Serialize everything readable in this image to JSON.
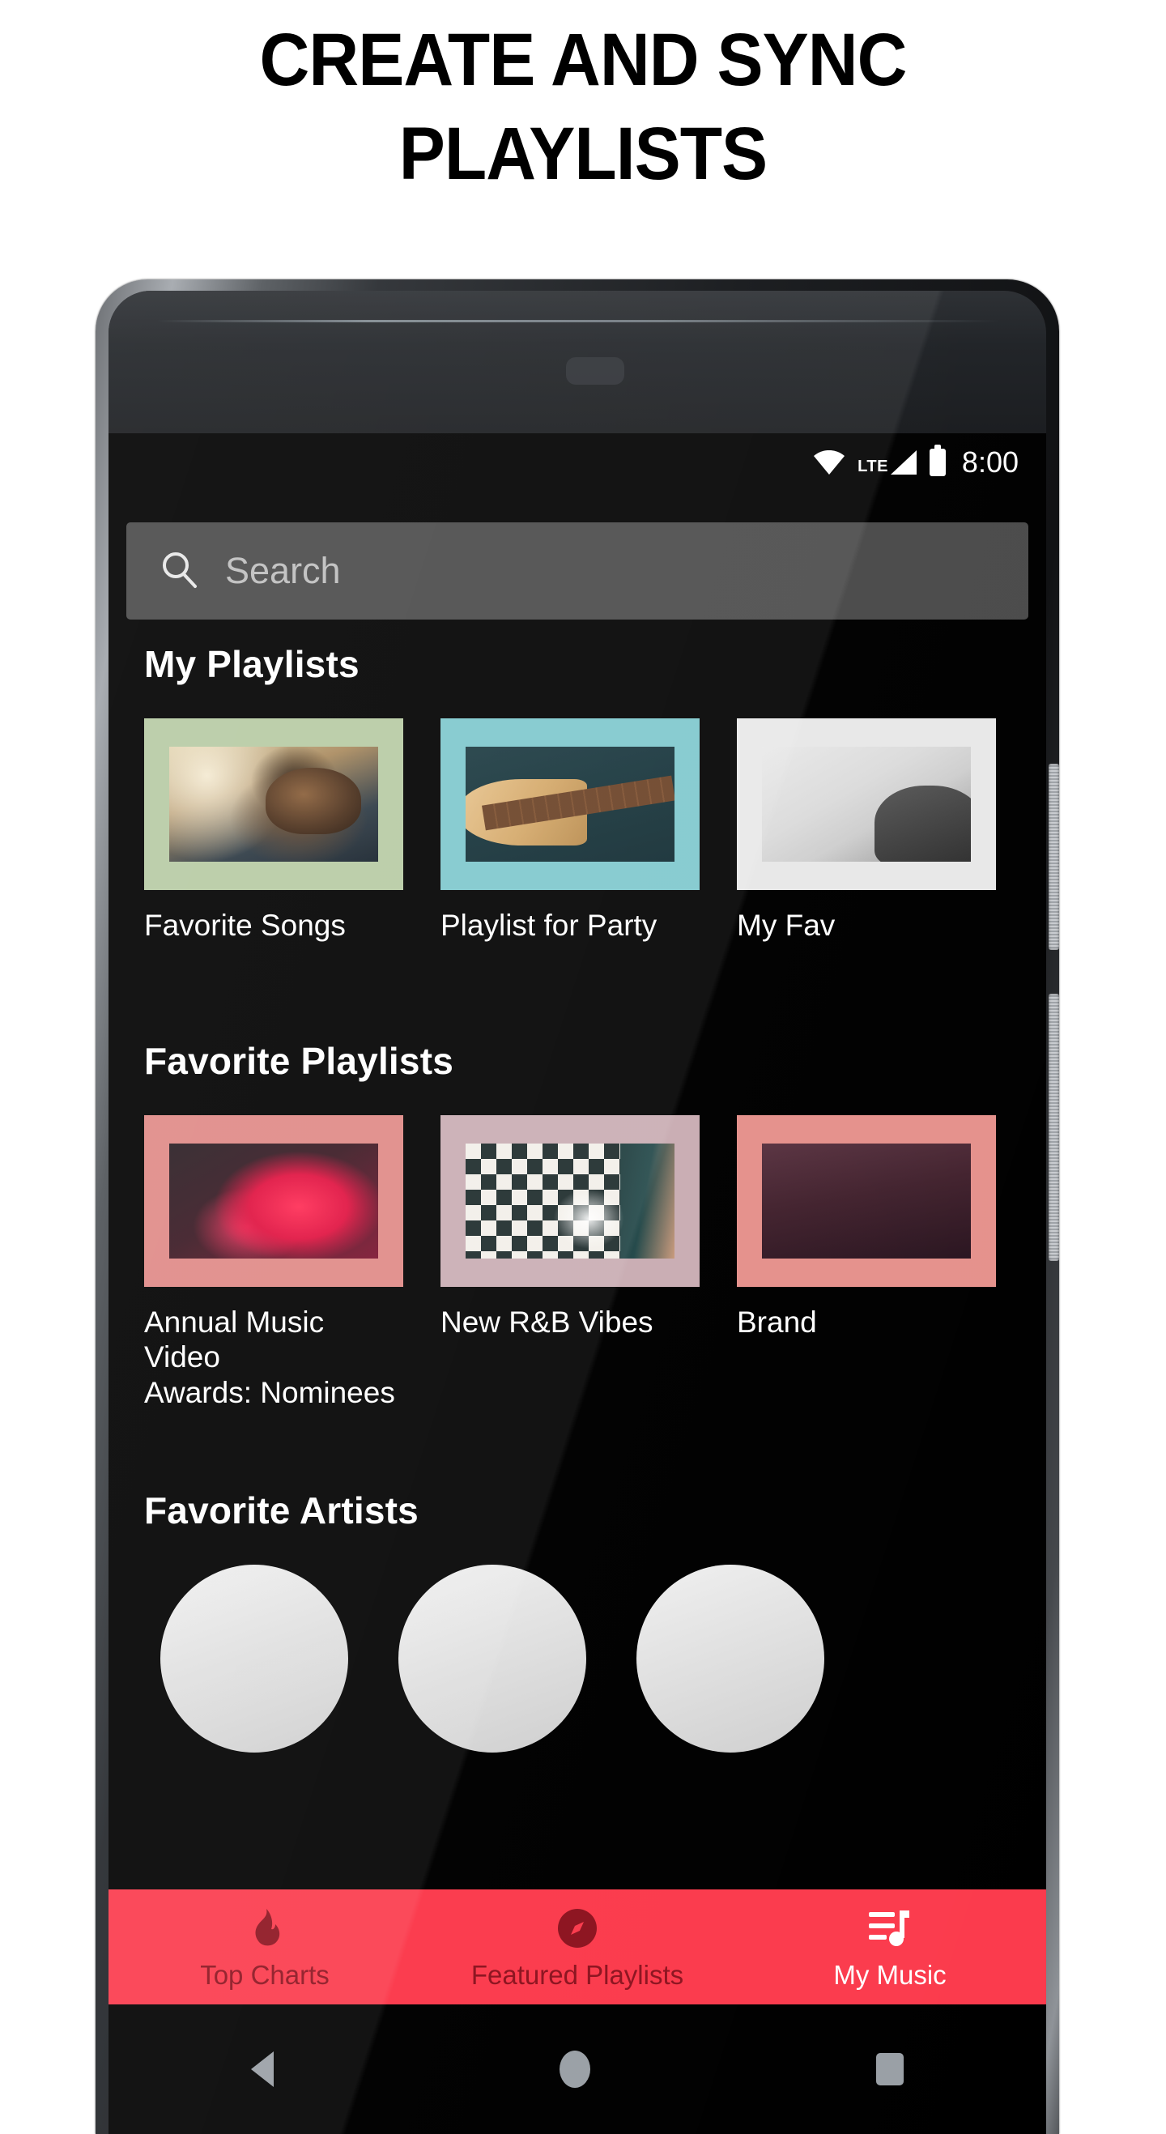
{
  "headline": {
    "line1": "CREATE AND SYNC",
    "line2": "PLAYLISTS"
  },
  "device": {
    "type": "android-phone",
    "accent_color": "#fb3b4d",
    "screen_bg": "#000000"
  },
  "statusbar": {
    "wifi_icon": "wifi-icon",
    "network_label": "LTE",
    "signal_icon": "signal-icon",
    "battery_icon": "battery-icon",
    "time": "8:00"
  },
  "search": {
    "icon": "search-icon",
    "placeholder": "Search",
    "value": ""
  },
  "sections": [
    {
      "title": "My Playlists",
      "cards": [
        {
          "label": "Favorite Songs",
          "frame_color": "#b7cba4",
          "art": "ph-singer"
        },
        {
          "label": "Playlist for Party",
          "frame_color": "#7fc8cd",
          "art": "ph-guitar"
        },
        {
          "label": "My Fav",
          "frame_color": "#e8e8e8",
          "art": "ph-bw"
        }
      ]
    },
    {
      "title": "Favorite Playlists",
      "cards": [
        {
          "label": "Annual Music Video\nAwards: Nominees",
          "frame_color": "#e08a87",
          "art": "ph-smoke"
        },
        {
          "label": "New R&B Vibes",
          "frame_color": "#c9adb3",
          "art": "ph-tiles"
        },
        {
          "label": "Brand",
          "frame_color": "#e5918c",
          "art": "ph-dark"
        }
      ]
    },
    {
      "title": "Favorite Artists",
      "cards": []
    }
  ],
  "app_nav": {
    "items": [
      {
        "label": "Top Charts",
        "icon": "flame-icon",
        "active": false
      },
      {
        "label": "Featured Playlists",
        "icon": "compass-icon",
        "active": false
      },
      {
        "label": "My Music",
        "icon": "playlist-icon",
        "active": true
      }
    ]
  },
  "system_nav": {
    "back": "back-triangle-icon",
    "home": "home-circle-icon",
    "recents": "recents-square-icon"
  }
}
